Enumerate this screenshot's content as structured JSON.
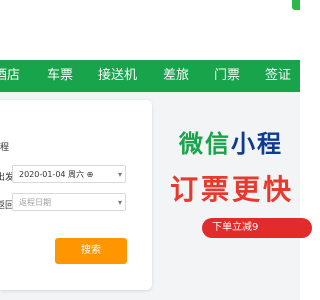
{
  "nav": {
    "items": [
      "酒店",
      "车票",
      "接送机",
      "差旅",
      "门票",
      "签证"
    ]
  },
  "form": {
    "partial_label": "程",
    "depart_label": "出发时间",
    "depart_value": "2020-01-04 周六 ⊕",
    "return_label": "返回日期",
    "return_placeholder": "返程日期",
    "search_label": "搜索"
  },
  "banner": {
    "line1_a": "微信",
    "line1_b": "小程",
    "line2": "订票更快",
    "promo": "下单立减9"
  },
  "colors": {
    "brand_green": "#17a44a",
    "search_orange": "#ff9500",
    "promo_red": "#e22b2b"
  }
}
